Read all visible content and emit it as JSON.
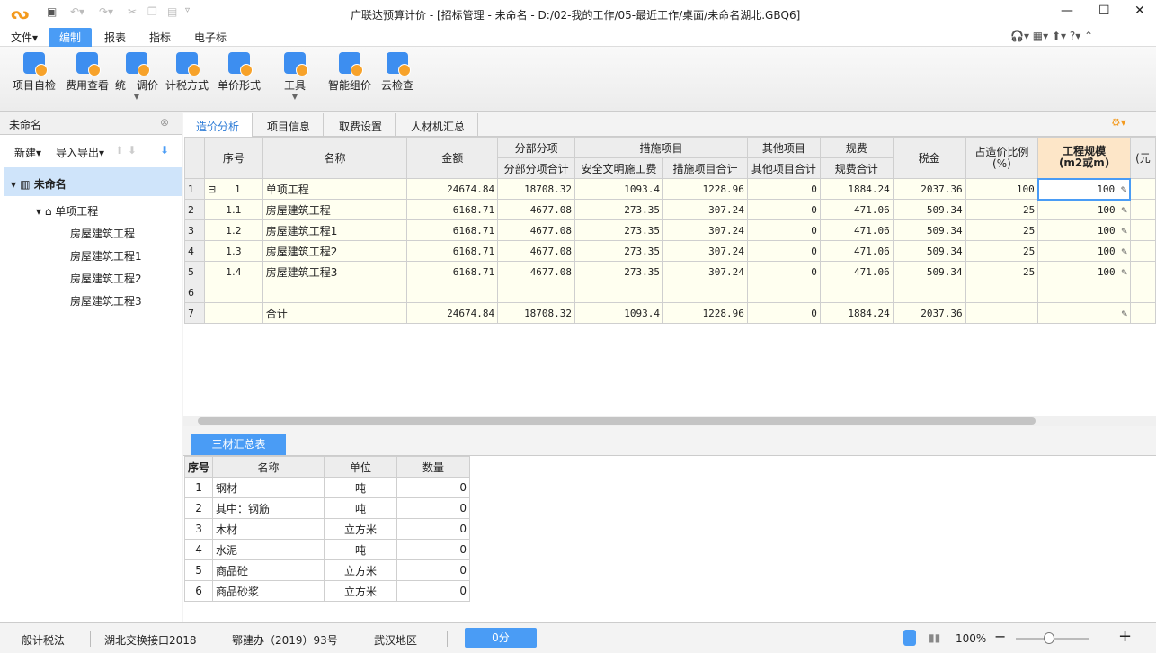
{
  "titlebar": {
    "title": "广联达预算计价 - [招标管理 - 未命名 - D:/02-我的工作/05-最近工作/桌面/未命名湖北.GBQ6]"
  },
  "menu": [
    "文件",
    "编制",
    "报表",
    "指标",
    "电子标"
  ],
  "ribbon": [
    "项目自检",
    "费用查看",
    "统一调价",
    "计税方式",
    "单价形式",
    "工具",
    "智能组价",
    "云检查"
  ],
  "left": {
    "title": "未命名",
    "new": "新建",
    "import_export": "导入导出",
    "tree": [
      "未命名",
      "单项工程",
      "房屋建筑工程",
      "房屋建筑工程1",
      "房屋建筑工程2",
      "房屋建筑工程3"
    ]
  },
  "tabs": [
    "造价分析",
    "项目信息",
    "取费设置",
    "人材机汇总"
  ],
  "grid": {
    "group_headers": [
      "分部分项",
      "措施项目",
      "其他项目",
      "规费"
    ],
    "headers": [
      "序号",
      "名称",
      "金额",
      "分部分项合计",
      "安全文明施工费",
      "措施项目合计",
      "其他项目合计",
      "规费合计",
      "税金",
      "占造价比例\n(%)",
      "工程规模\n(m2或m)",
      "(元"
    ],
    "rows": [
      [
        "1",
        "1",
        "单项工程",
        "24674.84",
        "18708.32",
        "1093.4",
        "1228.96",
        "0",
        "1884.24",
        "2037.36",
        "100",
        "100"
      ],
      [
        "2",
        "1.1",
        "房屋建筑工程",
        "6168.71",
        "4677.08",
        "273.35",
        "307.24",
        "0",
        "471.06",
        "509.34",
        "25",
        "100"
      ],
      [
        "3",
        "1.2",
        "房屋建筑工程1",
        "6168.71",
        "4677.08",
        "273.35",
        "307.24",
        "0",
        "471.06",
        "509.34",
        "25",
        "100"
      ],
      [
        "4",
        "1.3",
        "房屋建筑工程2",
        "6168.71",
        "4677.08",
        "273.35",
        "307.24",
        "0",
        "471.06",
        "509.34",
        "25",
        "100"
      ],
      [
        "5",
        "1.4",
        "房屋建筑工程3",
        "6168.71",
        "4677.08",
        "273.35",
        "307.24",
        "0",
        "471.06",
        "509.34",
        "25",
        "100"
      ],
      [
        "6",
        "",
        "",
        "",
        "",
        "",
        "",
        "",
        "",
        "",
        "",
        ""
      ],
      [
        "7",
        "",
        "合计",
        "24674.84",
        "18708.32",
        "1093.4",
        "1228.96",
        "0",
        "1884.24",
        "2037.36",
        "",
        ""
      ]
    ]
  },
  "bottom": {
    "tab": "三材汇总表",
    "headers": [
      "序号",
      "名称",
      "单位",
      "数量"
    ],
    "rows": [
      [
        "1",
        "钢材",
        "吨",
        "0"
      ],
      [
        "2",
        "其中：钢筋",
        "吨",
        "0"
      ],
      [
        "3",
        "木材",
        "立方米",
        "0"
      ],
      [
        "4",
        "水泥",
        "吨",
        "0"
      ],
      [
        "5",
        "商品砼",
        "立方米",
        "0"
      ],
      [
        "6",
        "商品砂浆",
        "立方米",
        "0"
      ]
    ]
  },
  "status": {
    "tax": "一般计税法",
    "interface": "湖北交换接口2018",
    "doc": "鄂建办（2019）93号",
    "region": "武汉地区",
    "score": "0分",
    "zoom": "100%"
  },
  "colors": {
    "accent": "#4a9cf5",
    "selected_header": "#fde6c8"
  }
}
